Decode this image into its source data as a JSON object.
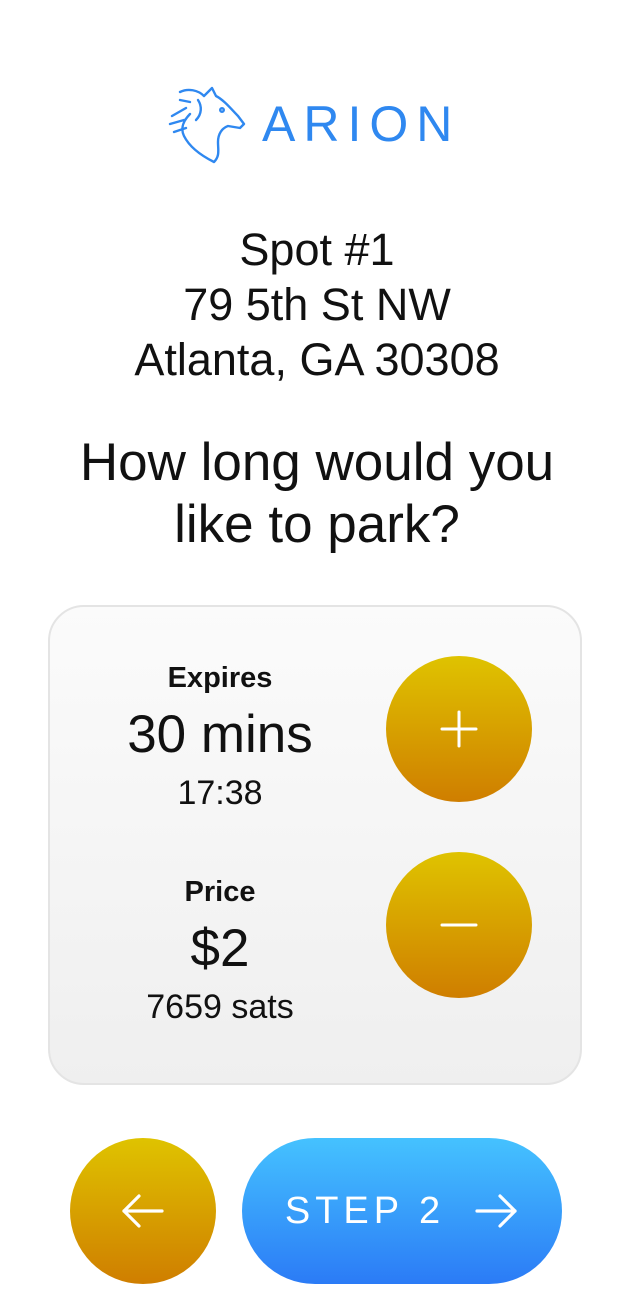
{
  "brand": {
    "name": "ARION",
    "logo_icon": "horse-head-icon",
    "color": "#2f88f0"
  },
  "spot": {
    "title": "Spot #1",
    "street": "79 5th St NW",
    "city": "Atlanta, GA 30308"
  },
  "question": {
    "line1": "How long would you",
    "line2": "like to park?"
  },
  "duration": {
    "label": "Expires",
    "value": "30 mins",
    "time": "17:38"
  },
  "price": {
    "label": "Price",
    "value": "$2",
    "sats": "7659 sats"
  },
  "controls": {
    "increase_icon": "plus-icon",
    "decrease_icon": "minus-icon"
  },
  "nav": {
    "back_icon": "arrow-left-icon",
    "next_label": "STEP 2",
    "next_icon": "arrow-right-icon"
  },
  "colors": {
    "gold_top": "#dfc300",
    "gold_bottom": "#cf7e00",
    "blue_top": "#45c2ff",
    "blue_bottom": "#2b7bf6"
  }
}
